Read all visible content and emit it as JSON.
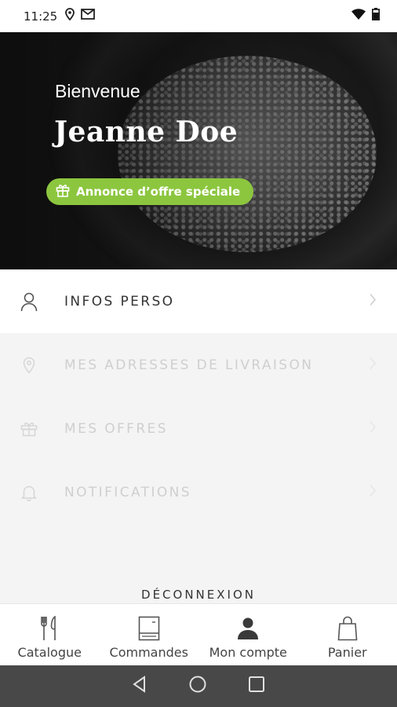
{
  "status_bar": {
    "time": "11:25",
    "icons_left": [
      "location-icon",
      "gmail-icon"
    ],
    "icons_right": [
      "wifi-icon",
      "battery-icon"
    ]
  },
  "hero": {
    "welcome": "Bienvenue",
    "user_name": "Jeanne Doe",
    "promo_label": "Annonce d’offre spéciale",
    "promo_color": "#8cc63f"
  },
  "menu": {
    "items": [
      {
        "label": "INFOS PERSO",
        "icon": "user-icon",
        "state": "active"
      },
      {
        "label": "MES ADRESSES DE LIVRAISON",
        "icon": "location-pin-icon",
        "state": "dimmed"
      },
      {
        "label": "MES OFFRES",
        "icon": "gift-icon",
        "state": "dimmed"
      },
      {
        "label": "NOTIFICATIONS",
        "icon": "bell-icon",
        "state": "dimmed"
      }
    ],
    "logout_label": "DÉCONNEXION"
  },
  "bottom_nav": {
    "tabs": [
      {
        "label": "Catalogue",
        "icon": "fork-knife-icon"
      },
      {
        "label": "Commandes",
        "icon": "order-document-icon"
      },
      {
        "label": "Mon compte",
        "icon": "account-icon",
        "selected": true
      },
      {
        "label": "Panier",
        "icon": "shopping-bag-icon"
      }
    ]
  },
  "system_nav": {
    "buttons": [
      "back-icon",
      "home-icon",
      "recents-icon"
    ]
  }
}
